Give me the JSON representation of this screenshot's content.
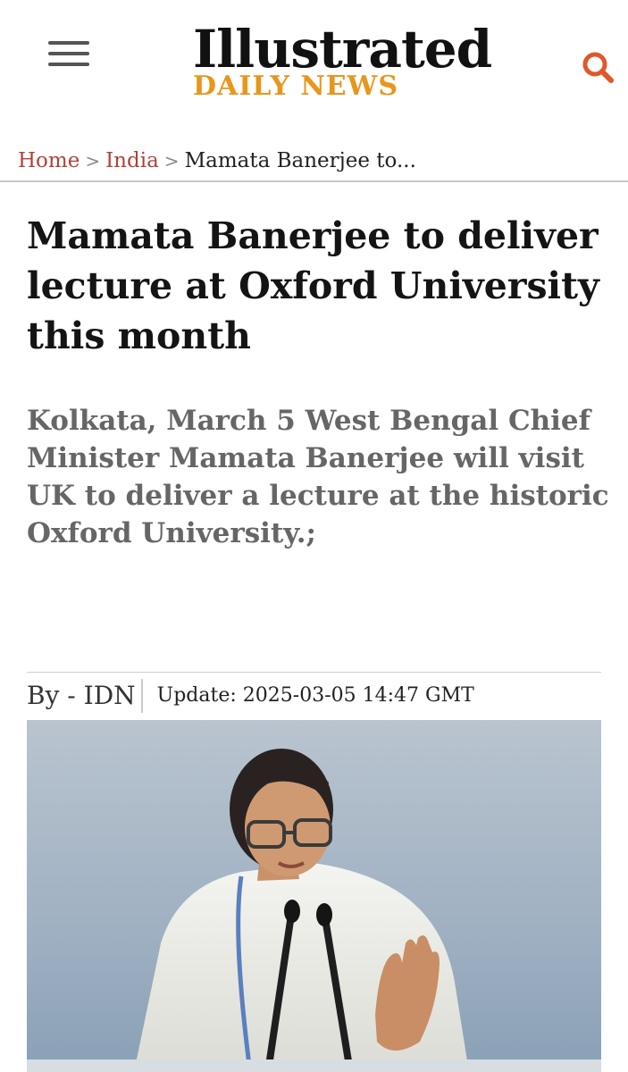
{
  "header": {
    "logo_main": "Illustrated",
    "logo_sub": "DAILY NEWS",
    "menu_icon": "hamburger-menu-icon",
    "search_icon": "search-icon",
    "accent_color": "#e8961c",
    "search_color": "#e0582a"
  },
  "breadcrumb": {
    "items": [
      {
        "label": "Home"
      },
      {
        "label": "India"
      }
    ],
    "separator": ">",
    "current": "Mamata Banerjee to..."
  },
  "article": {
    "headline": "Mamata Banerjee to deliver lecture at Oxford University this month",
    "summary": "Kolkata, March 5 West Bengal Chief Minister Mamata Banerjee will visit UK to deliver a lecture at the historic Oxford University.;",
    "byline": "By - IDN",
    "update_label": "Update:",
    "update_time": "2025-03-05 14:47 GMT"
  }
}
